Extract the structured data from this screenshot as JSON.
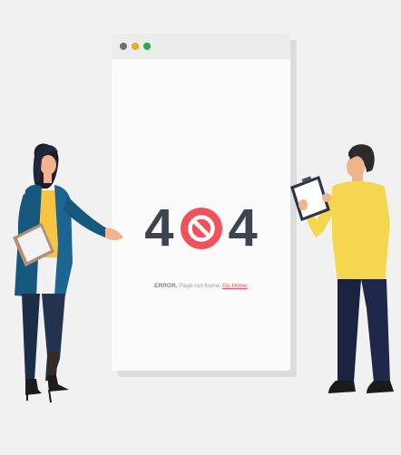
{
  "error_page": {
    "code_left": "4",
    "code_right": "4",
    "error_label": "ERROR.",
    "message": "Page not found.",
    "link_label": "Go Home"
  },
  "window": {
    "dots": [
      "gray",
      "orange",
      "green"
    ]
  },
  "icons": {
    "code_center": "no-entry-icon"
  },
  "colors": {
    "background": "#f1f1f2",
    "digits": "#3d4350",
    "accent_red": "#f0525c",
    "dot_gray": "#6d6e70",
    "dot_orange": "#f5a623",
    "dot_green": "#1fae4c"
  }
}
